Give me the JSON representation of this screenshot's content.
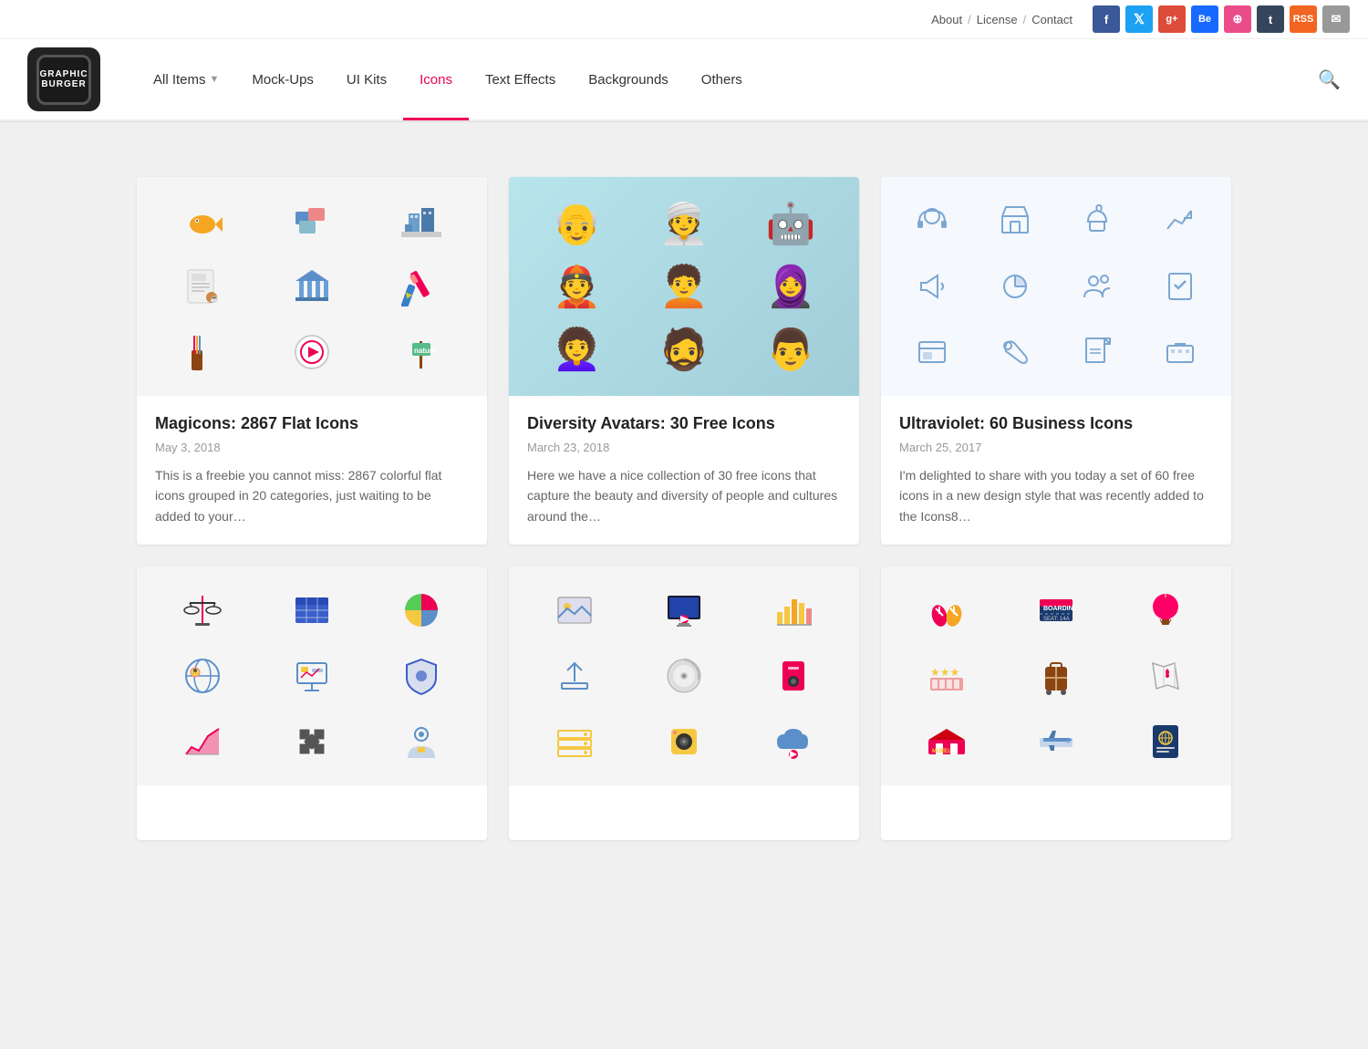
{
  "topbar": {
    "links": [
      "About",
      "License",
      "Contact"
    ],
    "separators": [
      "/",
      "/"
    ],
    "social": [
      {
        "name": "facebook",
        "label": "f",
        "class": "si-fb"
      },
      {
        "name": "twitter",
        "label": "t",
        "class": "si-tw"
      },
      {
        "name": "googleplus",
        "label": "g+",
        "class": "si-gp"
      },
      {
        "name": "behance",
        "label": "Be",
        "class": "si-be"
      },
      {
        "name": "dribbble",
        "label": "◉",
        "class": "si-dr"
      },
      {
        "name": "tumblr",
        "label": "t",
        "class": "si-tm"
      },
      {
        "name": "rss",
        "label": "◎",
        "class": "si-rss"
      },
      {
        "name": "email",
        "label": "✉",
        "class": "si-em"
      }
    ]
  },
  "header": {
    "logo_line1": "GRAPHIC",
    "logo_line2": "BURGER",
    "nav_items": [
      {
        "label": "All Items",
        "dropdown": true,
        "active": false
      },
      {
        "label": "Mock-Ups",
        "dropdown": false,
        "active": false
      },
      {
        "label": "UI Kits",
        "dropdown": false,
        "active": false
      },
      {
        "label": "Icons",
        "dropdown": false,
        "active": true
      },
      {
        "label": "Text Effects",
        "dropdown": false,
        "active": false
      },
      {
        "label": "Backgrounds",
        "dropdown": false,
        "active": false
      },
      {
        "label": "Others",
        "dropdown": false,
        "active": false
      }
    ]
  },
  "cards": [
    {
      "id": "card-1",
      "title": "Magicons: 2867 Flat Icons",
      "date": "May 3, 2018",
      "description": "This is a freebie you cannot miss: 2867 colorful flat icons grouped in 20 categories, just waiting to be added to your…",
      "bg_color": "#f8f8f8",
      "icons": [
        "🐟",
        "📦",
        "🏙",
        "📄",
        "🏛",
        "✏",
        "📚",
        "▶",
        "🪴"
      ]
    },
    {
      "id": "card-2",
      "title": "Diversity Avatars: 30 Free Icons",
      "date": "March 23, 2018",
      "description": "Here we have a nice collection of 30 free icons that capture the beauty and diversity of people and cultures around the…",
      "bg_color": "#a8d8e0",
      "icons": [
        "👴",
        "👳",
        "🤖",
        "👲",
        "👱",
        "🧕",
        "👩",
        "🧔",
        "👨"
      ]
    },
    {
      "id": "card-3",
      "title": "Ultraviolet: 60 Business Icons",
      "date": "March 25, 2017",
      "description": "I'm delighted to share with you today a set of 60 free icons in a new design style that was recently added to the Icons8…",
      "bg_color": "#f8f8f8",
      "icons": [
        "👤",
        "🏪",
        "🧁",
        "📈",
        "📢",
        "💿",
        "👥",
        "✅",
        "🖥",
        "🔧",
        "📋",
        "⌨"
      ]
    },
    {
      "id": "card-4",
      "title": "",
      "date": "",
      "description": "",
      "bg_color": "#f8f8f8",
      "icons": [
        "⚖",
        "📊",
        "🥧",
        "🌐",
        "📋",
        "🛡",
        "📉",
        "🧩",
        "👤"
      ]
    },
    {
      "id": "card-5",
      "title": "",
      "date": "",
      "description": "",
      "bg_color": "#f8f8f8",
      "icons": [
        "🖼",
        "🖥",
        "📊",
        "⬆",
        "💿",
        "🎵",
        "💾",
        "🔊",
        "☁"
      ]
    },
    {
      "id": "card-6",
      "title": "",
      "date": "",
      "description": "",
      "bg_color": "#f8f8f8",
      "icons": [
        "👡",
        "✈",
        "🎈",
        "⭐",
        "🧳",
        "🗺",
        "🏨",
        "✈",
        "📘"
      ]
    }
  ]
}
